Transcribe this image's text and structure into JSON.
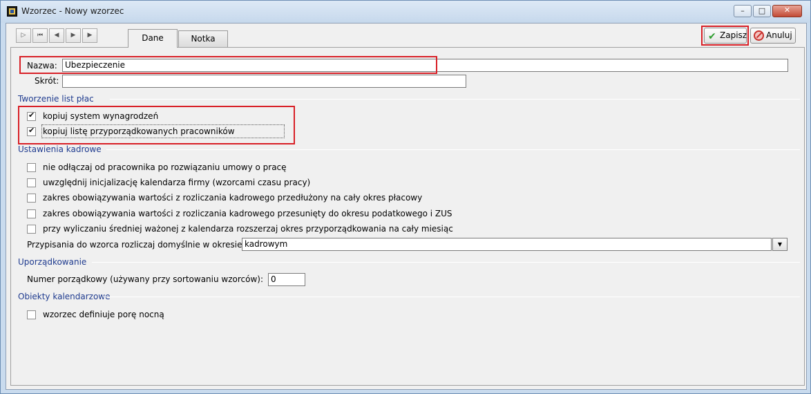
{
  "window": {
    "title": "Wzorzec - Nowy wzorzec",
    "minimize_glyph": "–",
    "maximize_glyph": "□",
    "close_glyph": "✕"
  },
  "nav": {
    "first": "▷",
    "prev_all": "⏮",
    "prev": "◀",
    "next": "▶",
    "last": "▶"
  },
  "tabs": [
    {
      "label": "Dane",
      "active": true
    },
    {
      "label": "Notka",
      "active": false
    }
  ],
  "actions": {
    "save_label": "Zapisz",
    "cancel_label": "Anuluj"
  },
  "form": {
    "name_label": "Nazwa:",
    "name_value": "Ubezpieczenie",
    "short_label": "Skrót:",
    "short_value": ""
  },
  "sections": {
    "payroll": {
      "title": "Tworzenie list płac",
      "options": [
        {
          "label": "kopiuj system wynagrodzeń",
          "checked": true
        },
        {
          "label": "kopiuj listę przyporządkowanych pracowników",
          "checked": true
        }
      ]
    },
    "hr": {
      "title": "Ustawienia kadrowe",
      "options": [
        {
          "label": "nie odłączaj od pracownika po rozwiązaniu umowy o pracę",
          "checked": false
        },
        {
          "label": "uwzględnij inicjalizację kalendarza firmy (wzorcami czasu pracy)",
          "checked": false
        },
        {
          "label": "zakres obowiązywania wartości z rozliczania kadrowego przedłużony na cały okres płacowy",
          "checked": false
        },
        {
          "label": "zakres obowiązywania wartości z rozliczania kadrowego przesunięty do okresu podatkowego i ZUS",
          "checked": false
        },
        {
          "label": "przy wyliczaniu średniej ważonej z kalendarza rozszerzaj okres przyporządkowania na cały miesiąc",
          "checked": false
        }
      ],
      "period_label": "Przypisania do wzorca rozliczaj domyślnie w okresie:",
      "period_value": "kadrowym",
      "combo_glyph": "▼"
    },
    "ordering": {
      "title": "Uporządkowanie",
      "number_label": "Numer porządkowy (używany przy sortowaniu wzorców):",
      "number_value": "0"
    },
    "calendar": {
      "title": "Obiekty kalendarzowe",
      "options": [
        {
          "label": "wzorzec definiuje porę nocną",
          "checked": false
        }
      ]
    }
  }
}
